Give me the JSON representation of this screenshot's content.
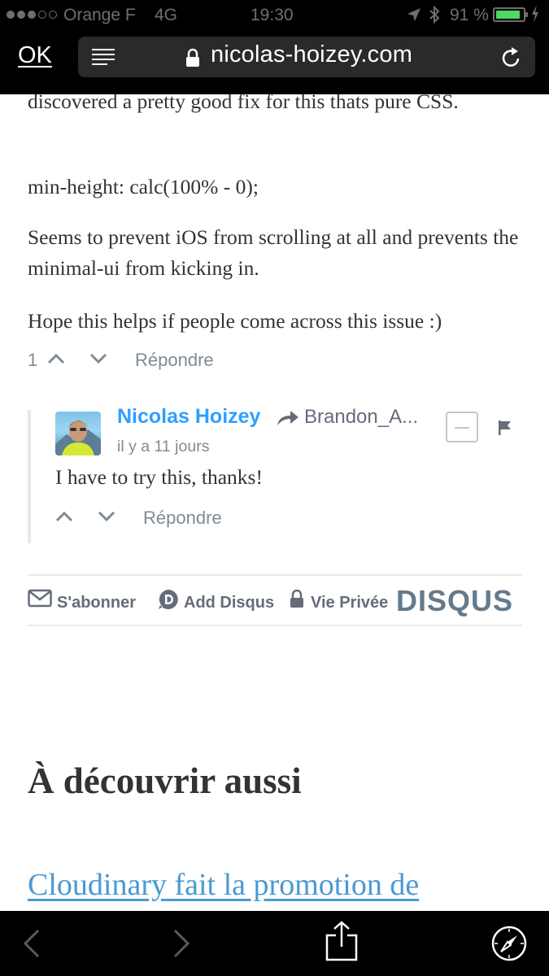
{
  "status_bar": {
    "carrier": "Orange F",
    "network": "4G",
    "time": "19:30",
    "battery_percent": "91 %",
    "battery_level": 0.91,
    "battery_color": "#4cd964"
  },
  "browser": {
    "done_label": "OK",
    "url": "nicolas-hoizey.com",
    "icons": [
      "reader-icon",
      "lock-icon",
      "reload-icon"
    ]
  },
  "comment": {
    "paragraphs": [
      "discovered a pretty good fix for this thats pure CSS.",
      "min-height: calc(100% - 0);",
      "Seems to prevent iOS from scrolling at all and prevents the minimal-ui from kicking in.",
      "Hope this helps if people come across this issue :)"
    ],
    "vote_count": "1",
    "reply_label": "Répondre"
  },
  "reply": {
    "author": "Nicolas Hoizey",
    "in_reply_to": "Brandon_A...",
    "timestamp": "il y a 11 jours",
    "text": "I have to try this, thanks!",
    "reply_label": "Répondre",
    "author_color": "#2e9fff"
  },
  "footer": {
    "subscribe_label": "S'abonner",
    "add_disqus_label": "Add Disqus",
    "privacy_label": "Vie Privée",
    "logo": "DISQUS"
  },
  "related": {
    "title": "À découvrir aussi",
    "link_text": "Cloudinary fait la promotion de"
  },
  "toolbar": {
    "icons": [
      "back-icon",
      "forward-icon",
      "share-icon",
      "safari-compass-icon"
    ]
  }
}
